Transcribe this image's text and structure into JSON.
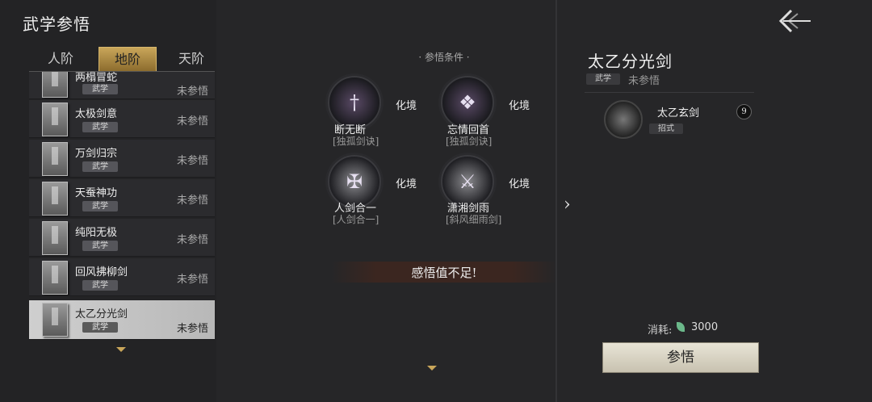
{
  "header": {
    "title": "武学参悟"
  },
  "tabs": [
    {
      "label": "人阶",
      "active": false
    },
    {
      "label": "地阶",
      "active": true
    },
    {
      "label": "天阶",
      "active": false
    }
  ],
  "list": [
    {
      "name": "两榻冒蛇",
      "tag": "武学",
      "status": "未参悟",
      "selected": false
    },
    {
      "name": "太极剑意",
      "tag": "武学",
      "status": "未参悟",
      "selected": false
    },
    {
      "name": "万剑归宗",
      "tag": "武学",
      "status": "未参悟",
      "selected": false
    },
    {
      "name": "天蚕神功",
      "tag": "武学",
      "status": "未参悟",
      "selected": false
    },
    {
      "name": "纯阳无极",
      "tag": "武学",
      "status": "未参悟",
      "selected": false
    },
    {
      "name": "回风拂柳剑",
      "tag": "武学",
      "status": "未参悟",
      "selected": false
    },
    {
      "name": "太乙分光剑",
      "tag": "武学",
      "status": "未参悟",
      "selected": true
    }
  ],
  "conditions": {
    "label": "·  参悟条件  ·",
    "items": [
      {
        "level": "化境",
        "name": "断无断",
        "source": "[独孤剑诀]",
        "icon": "sword-dark-icon"
      },
      {
        "level": "化境",
        "name": "忘情回首",
        "source": "[独孤剑诀]",
        "icon": "sword-dark-icon"
      },
      {
        "level": "化境",
        "name": "人剑合一",
        "source": "[人剑合一]",
        "icon": "sword-light-icon"
      },
      {
        "level": "化境",
        "name": "潇湘剑雨",
        "source": "[斜风细雨剑]",
        "icon": "sword-light-icon"
      }
    ]
  },
  "warning": "感悟值不足!",
  "detail": {
    "title": "太乙分光剑",
    "tag": "武学",
    "status": "未参悟",
    "sub_item": {
      "name": "太乙玄剑",
      "tag": "招式",
      "count": "9"
    },
    "cost_label": "消耗:",
    "cost_value": "3000",
    "button_label": "参悟"
  },
  "colors": {
    "accent": "#c9a65a",
    "background": "#262628"
  }
}
